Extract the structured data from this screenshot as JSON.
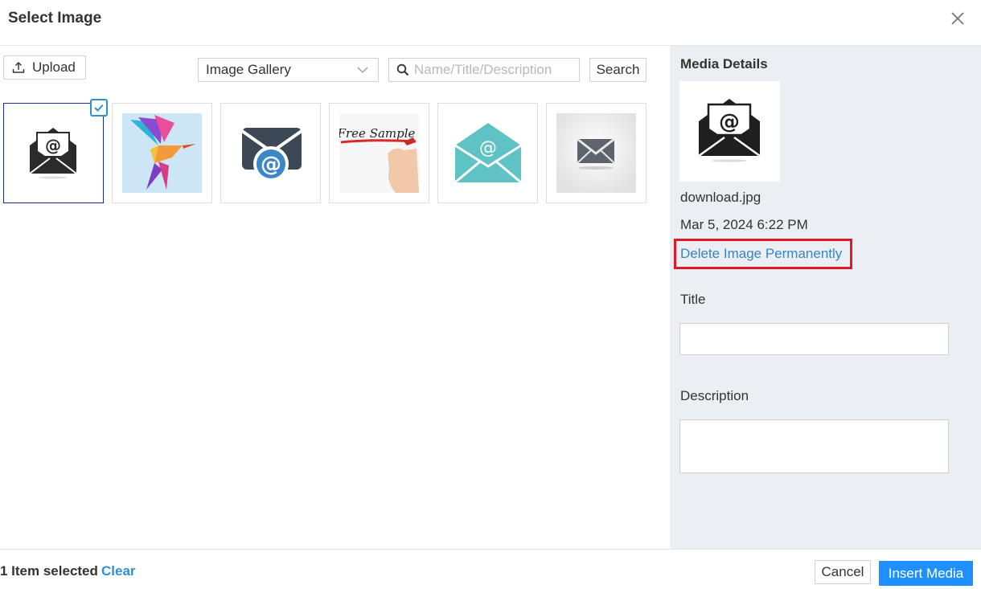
{
  "dialog": {
    "title": "Select Image",
    "close_icon": "close-icon"
  },
  "toolbar": {
    "upload_label": "Upload",
    "upload_icon": "upload-icon",
    "gallery_selected": "Image Gallery",
    "search_placeholder": "Name/Title/Description",
    "search_value": "",
    "search_label": "Search"
  },
  "gallery": {
    "images": [
      {
        "icon": "envelope-at-black-icon",
        "selected": true
      },
      {
        "icon": "hummingbird-image",
        "selected": false
      },
      {
        "icon": "envelope-at-slate-icon",
        "selected": false
      },
      {
        "icon": "free-sample-image",
        "selected": false,
        "text": "Free Sample"
      },
      {
        "icon": "envelope-at-teal-icon",
        "selected": false
      },
      {
        "icon": "envelope-gray-icon",
        "selected": false
      }
    ]
  },
  "media_details": {
    "heading": "Media Details",
    "filename": "download.jpg",
    "date": "Mar 5, 2024 6:22 PM",
    "delete_label": "Delete Image Permanently",
    "title_label": "Title",
    "title_value": "",
    "description_label": "Description",
    "description_value": ""
  },
  "footer": {
    "selected_count": "1 Item selected",
    "clear_label": "Clear",
    "cancel_label": "Cancel",
    "insert_label": "Insert Media"
  },
  "colors": {
    "accent": "#1e90ff",
    "link": "#3a84c4",
    "highlight": "#e01a2a",
    "panel_bg": "#ebeef2"
  }
}
